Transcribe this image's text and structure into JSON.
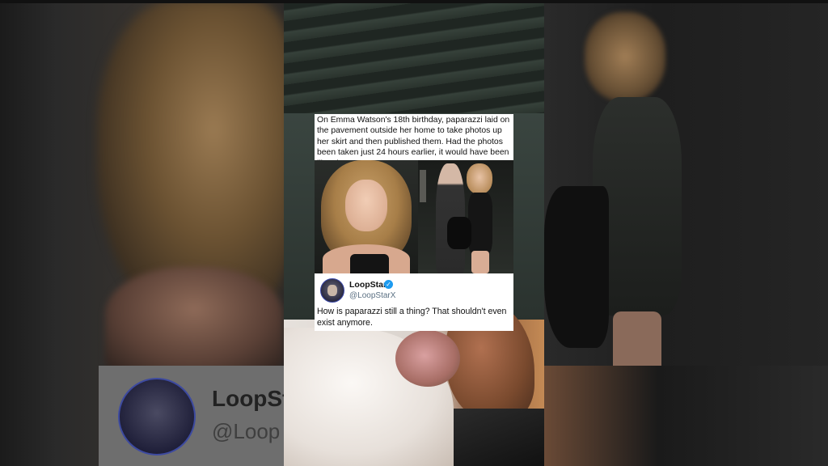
{
  "caption": "On Emma Watson's 18th birthday, paparazzi laid on the pavement outside her home to take photos up her skirt and then published them. Had the photos been taken just 24 hours earlier, it would have been illegal.",
  "tweet": {
    "name": "LoopStar",
    "handle": "@LoopStarX",
    "text": "How is paparazzi still a thing? That shouldn't even exist anymore."
  },
  "background_left": {
    "name_partial": "LoopSt",
    "handle_partial": "@Loop"
  },
  "icons": {
    "verified": "verified-badge-icon",
    "avatar": "dog-avatar"
  },
  "colors": {
    "verified_blue": "#1d9bf0",
    "handle_gray": "#5b7083"
  }
}
